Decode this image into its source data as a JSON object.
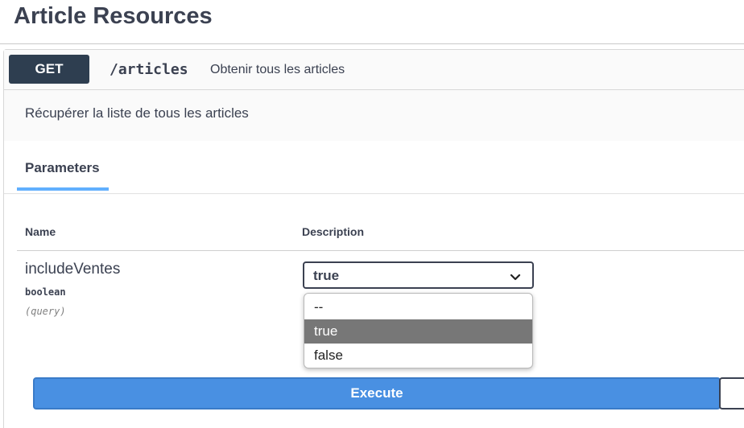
{
  "header": {
    "title": "Article Resources"
  },
  "operation": {
    "method": "GET",
    "path": "/articles",
    "summary": "Obtenir tous les articles",
    "description": "Récupérer la liste de tous les articles"
  },
  "parameters": {
    "tab_label": "Parameters",
    "columns": {
      "name": "Name",
      "description": "Description"
    },
    "items": [
      {
        "name": "includeVentes",
        "type": "boolean",
        "location": "(query)",
        "selected_value": "true",
        "options": [
          "--",
          "true",
          "false"
        ]
      }
    ]
  },
  "actions": {
    "execute_label": "Execute"
  },
  "colors": {
    "method_bg": "#2e3e50",
    "tab_underline": "#61affe",
    "execute_bg": "#4990e2",
    "option_highlight": "#777777"
  },
  "icons": {
    "select_arrow": "chevron-down-icon"
  }
}
